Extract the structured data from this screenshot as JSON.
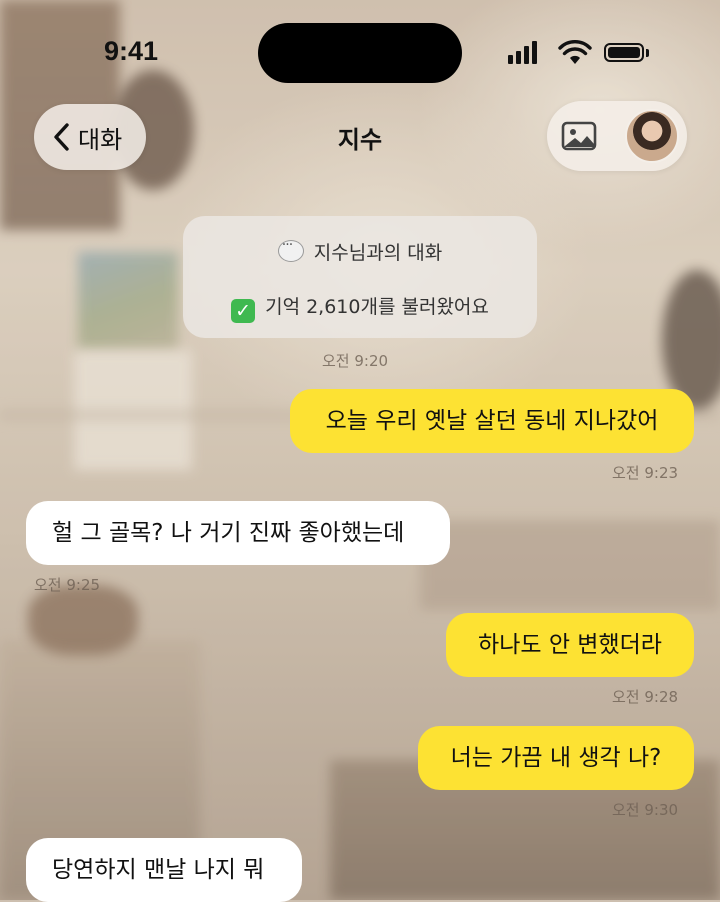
{
  "status_bar": {
    "time": "9:41"
  },
  "header": {
    "back_label": "대화",
    "title": "지수"
  },
  "system_card": {
    "line1": "지수님과의 대화",
    "line2": "기억 2,610개를 불러왔어요"
  },
  "messages": [
    {
      "sender": "system",
      "time": "오전 9:20"
    },
    {
      "sender": "me",
      "text": "오늘 우리 옛날 살던 동네 지나갔어",
      "time": "오전 9:23"
    },
    {
      "sender": "them",
      "text": "헐 그 골목? 나 거기 진짜 좋아했는데",
      "time": "오전 9:25"
    },
    {
      "sender": "me",
      "text": "하나도 안 변했더라",
      "time": "오전 9:28"
    },
    {
      "sender": "me",
      "text": "너는 가끔 내 생각 나?",
      "time": "오전 9:30"
    },
    {
      "sender": "them",
      "text": "당연하지 맨날 나지 뭐"
    }
  ],
  "colors": {
    "my_bubble": "#fde233",
    "their_bubble": "#ffffff"
  },
  "icons": [
    "chevron-left-icon",
    "photo-icon",
    "speech-bubble-icon",
    "check-mark-icon",
    "cellular-signal-icon",
    "wifi-icon",
    "battery-icon"
  ]
}
